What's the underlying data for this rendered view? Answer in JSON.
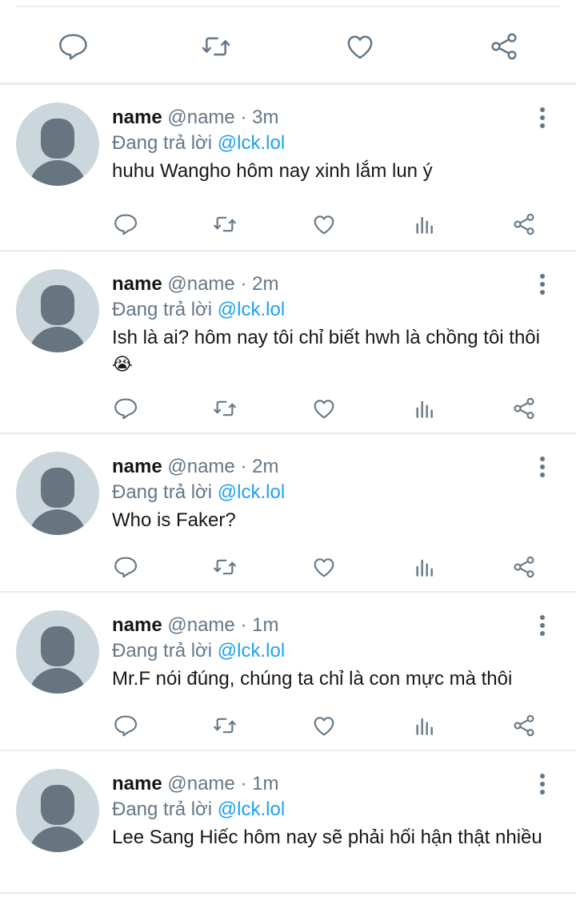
{
  "colors": {
    "icon_gray": "#657786",
    "link_blue": "#1da1f2",
    "divider": "#e6ecf0",
    "avatar_bg": "#ccd6dd",
    "avatar_fg": "#66757f"
  },
  "main_actions": {
    "icons": [
      "reply-icon",
      "retweet-icon",
      "like-icon",
      "share-icon"
    ]
  },
  "replies": [
    {
      "name": "name",
      "meta": " @name · 3m",
      "replying_prefix": "Đang trả lời ",
      "replying_handle": "@lck.lol",
      "text": "huhu Wangho hôm nay xinh lắm lun ý",
      "emoji": ""
    },
    {
      "name": "name",
      "meta": " @name · 2m",
      "replying_prefix": "Đang trả lời ",
      "replying_handle": "@lck.lol",
      "text": "Ish là ai? hôm nay tôi chỉ biết hwh là chồng tôi thôi",
      "emoji": "😭"
    },
    {
      "name": "name",
      "meta": " @name · 2m",
      "replying_prefix": "Đang trả lời ",
      "replying_handle": "@lck.lol",
      "text": "Who is Faker?",
      "emoji": ""
    },
    {
      "name": "name",
      "meta": " @name · 1m",
      "replying_prefix": "Đang trả lời ",
      "replying_handle": "@lck.lol",
      "text": "Mr.F nói đúng, chúng ta chỉ là con mực mà thôi",
      "emoji": ""
    },
    {
      "name": "name",
      "meta": " @name · 1m",
      "replying_prefix": "Đang trả lời ",
      "replying_handle": "@lck.lol",
      "text": "Lee Sang Hiếc hôm nay sẽ phải hối hận thật nhiều",
      "emoji": ""
    }
  ],
  "reply_actions": {
    "icons": [
      "reply-icon",
      "retweet-icon",
      "like-icon",
      "analytics-icon",
      "share-icon"
    ]
  }
}
